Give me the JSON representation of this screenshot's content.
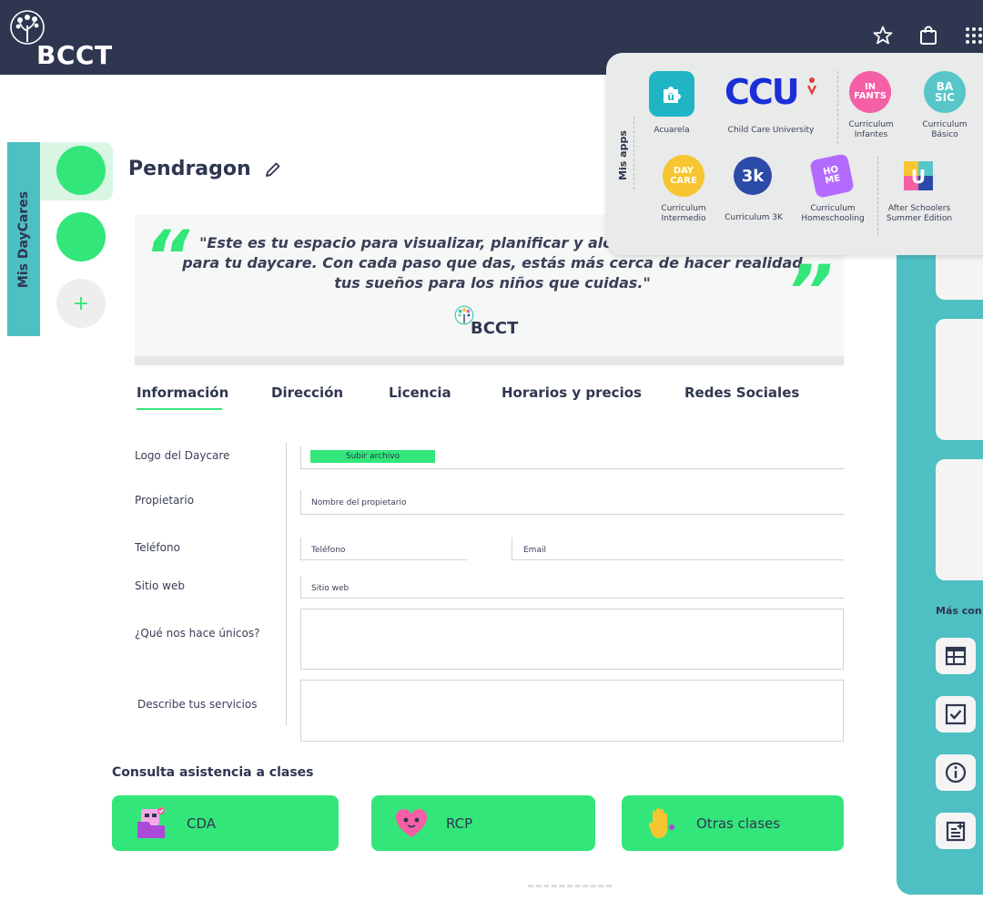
{
  "header": {
    "brand": "BCCT",
    "icons": [
      "star-icon",
      "bag-icon",
      "apps-grid-icon"
    ]
  },
  "sidebar": {
    "tab_label": "Mis DayCares",
    "add_label": "+"
  },
  "page": {
    "title": "Pendragon"
  },
  "quote": {
    "open_mark": "“",
    "close_mark": "”",
    "text": "\"Este es tu espacio para visualizar, planificar y alcanzar metas audaces para tu daycare. Con cada paso que das, estás más cerca de hacer realidad tus sueños para los niños que cuidas.\"",
    "logo_text": "BCCT"
  },
  "tabs": [
    "Información",
    "Dirección",
    "Licencia",
    "Horarios y precios",
    "Redes Sociales"
  ],
  "form": {
    "logo_label": "Logo del Daycare",
    "upload_label": "Subir archivo",
    "owner_label": "Propietario",
    "owner_placeholder": "Nombre del propietario",
    "phone_label": "Teléfono",
    "phone_placeholder": "Teléfono",
    "email_placeholder": "Email",
    "website_label": "Sitio web",
    "website_placeholder": "Sitio web",
    "unique_label": "¿Qué nos hace únicos?",
    "services_label": "Describe tus servicios"
  },
  "attendance": {
    "title": "Consulta asistencia a clases",
    "buttons": [
      "CDA",
      "RCP",
      "Otras clases"
    ]
  },
  "right_panel": {
    "more_label": "Más con"
  },
  "apps": {
    "label": "Mis apps",
    "row1": [
      {
        "name": "Acuarela",
        "icon_text": "ü"
      },
      {
        "name": "Child Care University",
        "icon_text": "CCU"
      },
      {
        "name": "Curriculum\nInfantes",
        "icon_text": "IN\nFANTS"
      },
      {
        "name": "Curriculum\nBásico",
        "icon_text": "BA\nSIC"
      }
    ],
    "row2": [
      {
        "name": "Curriculum\nIntermedio",
        "icon_text": "DAY\nCARE"
      },
      {
        "name": "Curriculum 3K",
        "icon_text": "3k"
      },
      {
        "name": "Curriculum\nHomeschooling",
        "icon_text": "HO\nME"
      },
      {
        "name": "After Schoolers\nSummer Edition",
        "icon_text": "U"
      }
    ]
  },
  "colors": {
    "navy": "#2f3650",
    "green": "#33e67a",
    "teal": "#4ebfc3",
    "acuarela": "#1fb5c4",
    "ccu_blue": "#1a2fd6",
    "ccu_red": "#e0403a",
    "infants_pink": "#f45fa6",
    "basic_teal": "#57c6c9",
    "daycare_yellow": "#f7c531",
    "k3_blue": "#2c4aa8",
    "home_purple": "#b36bff"
  }
}
